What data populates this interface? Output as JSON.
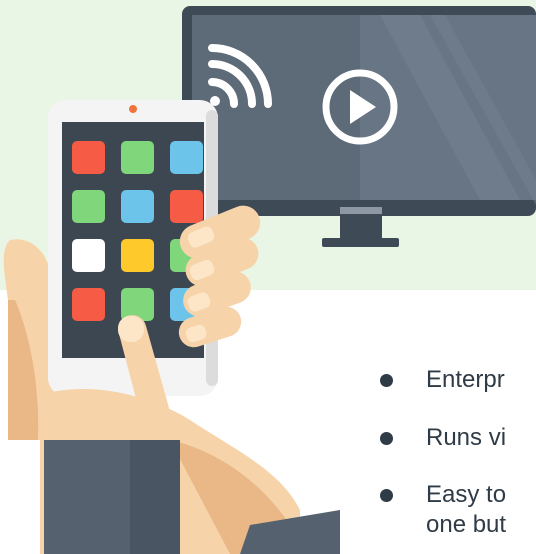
{
  "colors": {
    "band": "#e9f6e6",
    "tv_frame": "#3e4a56",
    "tv_screen": "#5d6a78",
    "phone_body": "#f4f4f4",
    "phone_screen": "#3d4752",
    "skin": "#f6d3a8",
    "skin_shadow": "#e9b886",
    "sleeve": "#55616e",
    "text": "#2f3b46"
  },
  "icons": {
    "cast": "wifi-cast-icon",
    "play": "play-circle-icon"
  },
  "app_tile_colors": [
    [
      "#f55b45",
      "#7fd67b",
      "#6cc4ea"
    ],
    [
      "#7fd67b",
      "#6cc4ea",
      "#f55b45"
    ],
    [
      "#ffffff",
      "#fdc92b",
      "#7fd67b"
    ],
    [
      "#f55b45",
      "#7fd67b",
      "#6cc4ea"
    ]
  ],
  "bullets": [
    {
      "text": "Enterpr"
    },
    {
      "text": "Runs vi"
    },
    {
      "text": "Easy to\none but"
    }
  ]
}
